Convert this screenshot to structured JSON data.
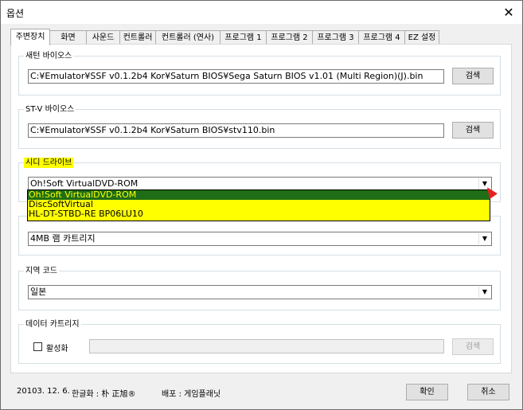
{
  "window": {
    "title": "옵션",
    "close_glyph": "✕"
  },
  "tabs": [
    {
      "label": "주변장치"
    },
    {
      "label": "화면"
    },
    {
      "label": "사운드"
    },
    {
      "label": "컨트롤러"
    },
    {
      "label": "컨트롤러 (연사)"
    },
    {
      "label": "프로그램 1"
    },
    {
      "label": "프로그램 2"
    },
    {
      "label": "프로그램 3"
    },
    {
      "label": "프로그램 4"
    },
    {
      "label": "EZ 설정"
    }
  ],
  "saturn_bios": {
    "label": "새턴 바이오스",
    "path": "C:¥Emulator¥SSF v0.1.2b4 Kor¥Saturn BIOS¥Sega Saturn BIOS v1.01 (Multi Region)(J).bin",
    "browse_label": "검색"
  },
  "stv_bios": {
    "label": "ST-V 바이오스",
    "path": "C:¥Emulator¥SSF v0.1.2b4 Kor¥Saturn BIOS¥stv110.bin",
    "browse_label": "검색"
  },
  "cd_drive": {
    "label": "시디 드라이브",
    "selected": "Oh!Soft VirtualDVD-ROM",
    "options": [
      "Oh!Soft VirtualDVD-ROM",
      "DiscSoftVirtual",
      "HL-DT-STBD-RE  BP06LU10"
    ]
  },
  "cartridge": {
    "selected": "4MB 램 카트리지"
  },
  "region": {
    "label": "지역 코드",
    "selected": "일본"
  },
  "data_cartridge": {
    "label": "데이터 카트리지",
    "enable_label": "활성화",
    "path": "",
    "browse_label": "검색"
  },
  "footer": {
    "date": "20103. 12. 6.",
    "translator": "한글화 : 朴 正旭®",
    "distributor": "배포 : 게임플래닛"
  },
  "buttons": {
    "ok": "확인",
    "cancel": "취소"
  }
}
